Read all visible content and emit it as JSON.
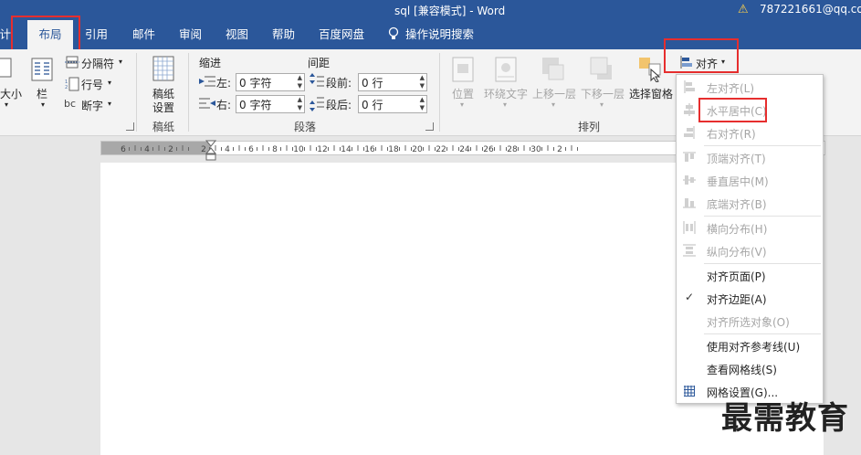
{
  "window": {
    "title": "sql [兼容模式]  -  Word",
    "account": "787221661@qq.co",
    "warning_icon": "warning-icon"
  },
  "tabs": [
    {
      "label": "设计"
    },
    {
      "label": "布局",
      "active": true
    },
    {
      "label": "引用"
    },
    {
      "label": "邮件"
    },
    {
      "label": "审阅"
    },
    {
      "label": "视图"
    },
    {
      "label": "帮助"
    },
    {
      "label": "百度网盘"
    },
    {
      "label": "操作说明搜索"
    }
  ],
  "ribbon": {
    "page_setup": {
      "size_label": "大小",
      "columns_label": "栏",
      "breaks_label": "分隔符",
      "line_numbers_label": "行号",
      "hyphenation_label": "断字"
    },
    "manuscript": {
      "button_label_1": "稿纸",
      "button_label_2": "设置",
      "group_label": "稿纸"
    },
    "paragraph": {
      "indent_heading": "缩进",
      "spacing_heading": "间距",
      "left_label": "左:",
      "left_value": "0 字符",
      "right_label": "右:",
      "right_value": "0 字符",
      "before_label": "段前:",
      "before_value": "0 行",
      "after_label": "段后:",
      "after_value": "0 行",
      "group_label": "段落"
    },
    "arrange": {
      "position_label": "位置",
      "wrap_label": "环绕文字",
      "forward_label": "上移一层",
      "backward_label": "下移一层",
      "selection_pane_label": "选择窗格",
      "align_label": "对齐",
      "group_label": "排列"
    }
  },
  "ruler": {
    "ticks": [
      "6",
      "4",
      "2",
      "2",
      "4",
      "6",
      "8",
      "10",
      "12",
      "14",
      "16",
      "18",
      "20",
      "22",
      "24",
      "26",
      "28",
      "30",
      "2"
    ]
  },
  "align_menu": {
    "items": [
      {
        "label": "左对齐(L)",
        "enabled": false,
        "icon": "align-left-icon"
      },
      {
        "label": "水平居中(C)",
        "enabled": false,
        "icon": "align-center-icon"
      },
      {
        "label": "右对齐(R)",
        "enabled": false,
        "icon": "align-right-icon"
      },
      {
        "label": "顶端对齐(T)",
        "enabled": false,
        "icon": "align-top-icon"
      },
      {
        "label": "垂直居中(M)",
        "enabled": false,
        "icon": "align-middle-icon"
      },
      {
        "label": "底端对齐(B)",
        "enabled": false,
        "icon": "align-bottom-icon"
      },
      {
        "label": "横向分布(H)",
        "enabled": false,
        "icon": "distribute-horizontal-icon"
      },
      {
        "label": "纵向分布(V)",
        "enabled": false,
        "icon": "distribute-vertical-icon"
      },
      {
        "label": "对齐页面(P)",
        "enabled": true
      },
      {
        "label": "对齐边距(A)",
        "enabled": true,
        "checked": true
      },
      {
        "label": "对齐所选对象(O)",
        "enabled": false
      },
      {
        "label": "使用对齐参考线(U)",
        "enabled": true
      },
      {
        "label": "查看网格线(S)",
        "enabled": true
      },
      {
        "label": "网格设置(G)...",
        "enabled": true,
        "icon": "grid-icon"
      }
    ]
  },
  "watermark": "最需教育",
  "colors": {
    "accent": "#2b579a",
    "highlight_box": "#e62e2e",
    "disabled_text": "#a6a6a6"
  }
}
